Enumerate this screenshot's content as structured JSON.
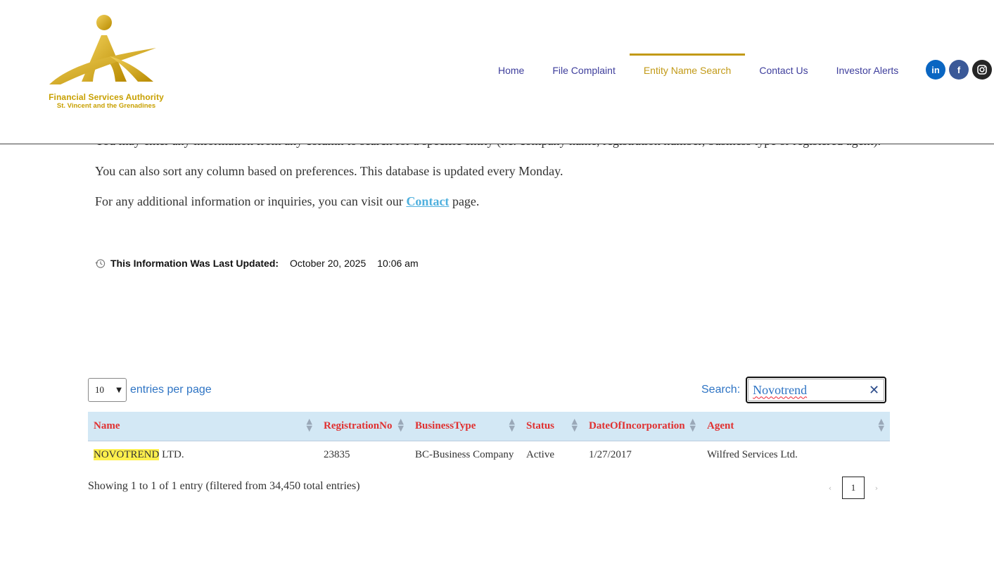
{
  "header": {
    "logo": {
      "line1": "Financial Services Authority",
      "line2": "St. Vincent and the Grenadines",
      "gold": "#d4a814"
    },
    "nav": [
      {
        "label": "Home",
        "active": false
      },
      {
        "label": "File Complaint",
        "active": false
      },
      {
        "label": "Entity Name Search",
        "active": true
      },
      {
        "label": "Contact Us",
        "active": false
      },
      {
        "label": "Investor Alerts",
        "active": false
      }
    ],
    "social": [
      {
        "icon": "linkedin-icon",
        "glyph": "in"
      },
      {
        "icon": "facebook-icon",
        "glyph": "f"
      },
      {
        "icon": "instagram-icon",
        "glyph": "◎"
      }
    ]
  },
  "intro": {
    "p1": "You may enter any information from any column to search for a specific entity (i.e. company name, registration number, business type or registered agent).",
    "p2": "You can also sort any column based on preferences. This database is updated every Monday.",
    "p3_before": "For any additional information or inquiries, you can visit our",
    "p3_link": "Contact",
    "p3_after": "page."
  },
  "updated": {
    "label": "This Information Was Last Updated:",
    "date": "October 20, 2025",
    "time": "10:06 am"
  },
  "table_controls": {
    "entries_value": "10",
    "entries_label": "entries per page",
    "search_label": "Search:",
    "search_value": "Novotrend"
  },
  "table": {
    "columns": [
      "Name",
      "RegistrationNo",
      "BusinessType",
      "Status",
      "DateOfIncorporation",
      "Agent"
    ],
    "rows": [
      {
        "name_highlight": "NOVOTREND",
        "name_rest": " LTD.",
        "registration_no": "23835",
        "business_type": "BC-Business Company",
        "status": "Active",
        "date_of_incorporation": "1/27/2017",
        "agent": "Wilfred Services Ltd."
      }
    ]
  },
  "footer": {
    "info": "Showing 1 to 1 of 1 entry (filtered from 34,450 total entries)",
    "prev": "‹",
    "page": "1",
    "next": "›"
  },
  "colors": {
    "nav": "#3e3e9c",
    "nav_active": "#c29a17",
    "table_header_bg": "#d3e8f5",
    "table_header_text": "#e03131",
    "highlight": "#fff04d",
    "control_text": "#2e74c4"
  }
}
